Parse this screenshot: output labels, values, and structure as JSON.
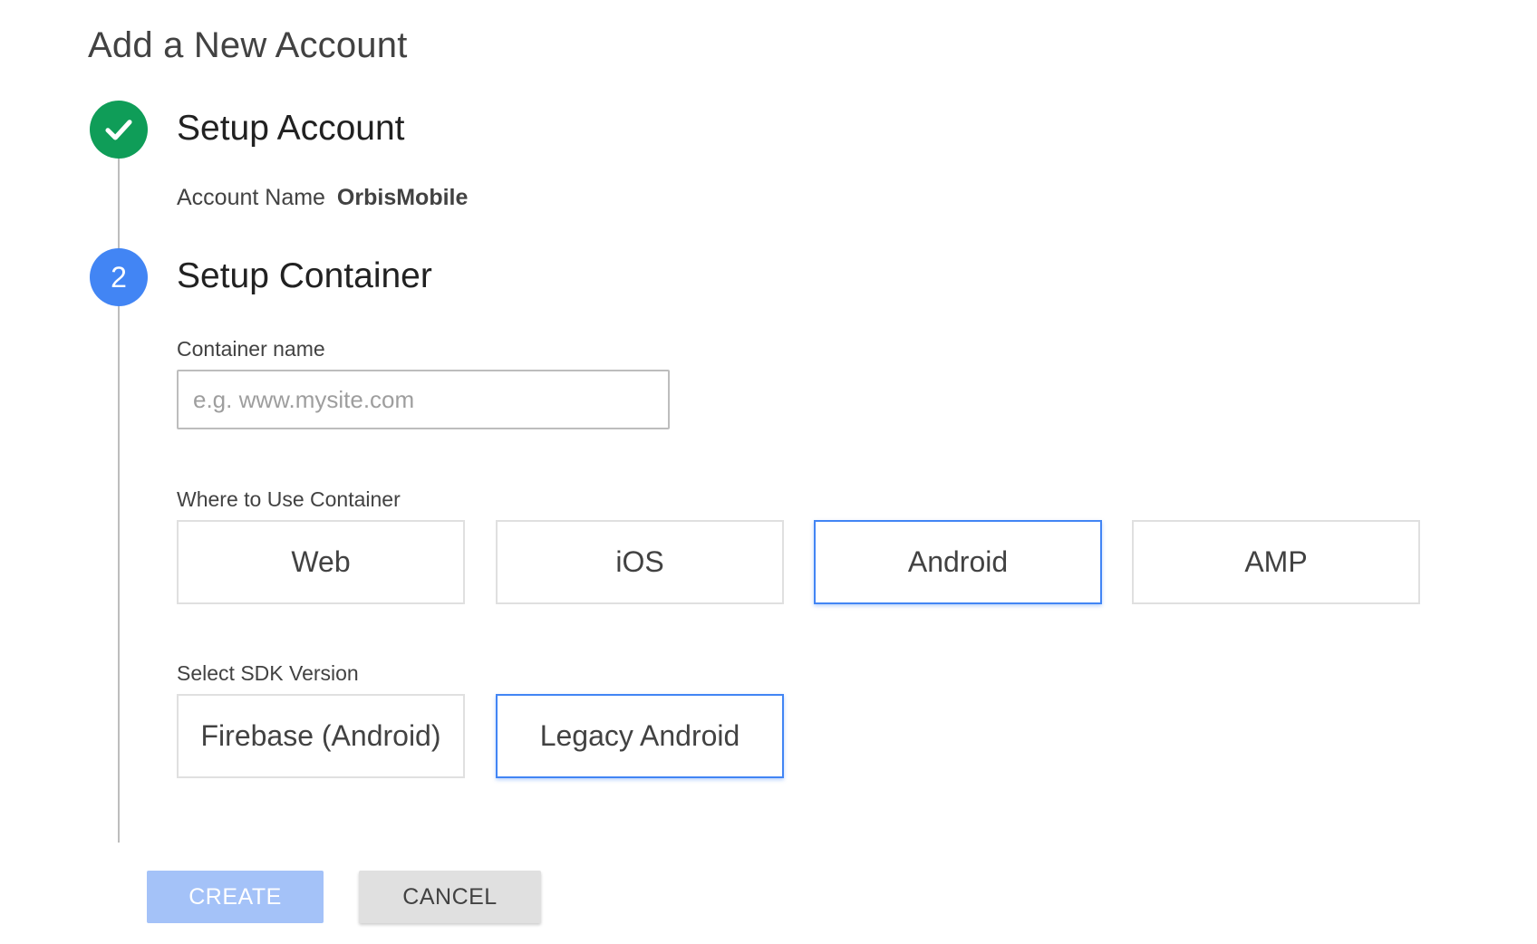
{
  "page": {
    "title": "Add a New Account"
  },
  "steps": [
    {
      "status": "complete",
      "icon": "check-icon",
      "title": "Setup Account",
      "color": "#0f9d58"
    },
    {
      "status": "active",
      "number": "2",
      "title": "Setup Container",
      "color": "#4285f4"
    }
  ],
  "account": {
    "label": "Account Name",
    "value": "OrbisMobile"
  },
  "container": {
    "name_label": "Container name",
    "name_value": "",
    "name_placeholder": "e.g. www.mysite.com",
    "where_label": "Where to Use Container",
    "where_options": [
      {
        "label": "Web",
        "selected": false
      },
      {
        "label": "iOS",
        "selected": false
      },
      {
        "label": "Android",
        "selected": true
      },
      {
        "label": "AMP",
        "selected": false
      }
    ],
    "sdk_label": "Select SDK Version",
    "sdk_options": [
      {
        "label": "Firebase (Android)",
        "selected": false
      },
      {
        "label": "Legacy Android",
        "selected": true
      }
    ]
  },
  "actions": {
    "create_label": "CREATE",
    "cancel_label": "CANCEL"
  },
  "colors": {
    "accent": "#4285f4",
    "success": "#0f9d58",
    "create_disabled": "#a4c2f8"
  }
}
